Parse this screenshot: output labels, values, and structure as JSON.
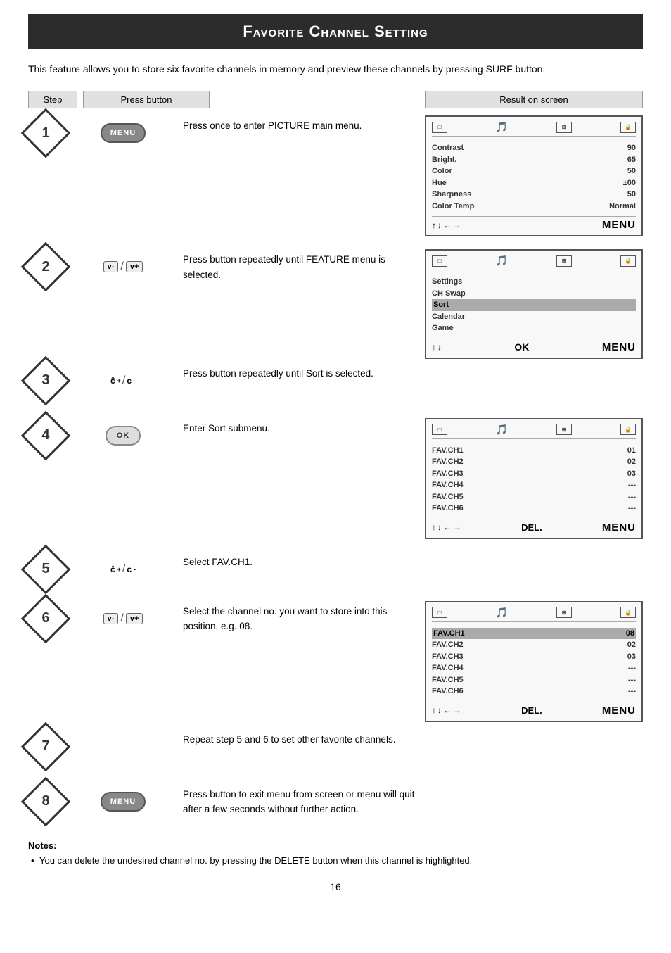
{
  "page": {
    "title": "Favorite Channel Setting",
    "intro": "This feature allows you to store six favorite channels in memory and preview these channels by pressing SURF button.",
    "page_number": "16",
    "col_step": "Step",
    "col_press": "Press  button",
    "col_result": "Result  on screen"
  },
  "steps": [
    {
      "number": "1",
      "button_type": "menu",
      "description": "Press once to enter PICTURE main menu.",
      "screen": {
        "type": "picture_menu",
        "items": [
          {
            "label": "Contrast",
            "value": "90"
          },
          {
            "label": "Bright.",
            "value": "65"
          },
          {
            "label": "Color",
            "value": "50"
          },
          {
            "label": "Hue",
            "value": "±00"
          },
          {
            "label": "Sharpness",
            "value": "50"
          },
          {
            "label": "Color Temp",
            "value": "Normal"
          }
        ],
        "nav": "menu_arrows",
        "menu_label": "MENU"
      }
    },
    {
      "number": "2",
      "button_type": "vminus_vplus",
      "description": "Press button repeatedly until FEATURE menu is selected.",
      "screen": {
        "type": "feature_menu",
        "items": [
          {
            "label": "Settings",
            "value": "",
            "highlighted": false
          },
          {
            "label": "CH Swap",
            "value": "",
            "highlighted": false
          },
          {
            "label": "Sort",
            "value": "",
            "highlighted": true
          },
          {
            "label": "Calendar",
            "value": "",
            "highlighted": false
          },
          {
            "label": "Game",
            "value": "",
            "highlighted": false
          }
        ],
        "nav": "ok_menu",
        "ok_label": "OK",
        "menu_label": "MENU"
      }
    },
    {
      "number": "3",
      "button_type": "channel",
      "description": "Press button repeatedly until Sort is selected.",
      "no_screen": true
    },
    {
      "number": "4",
      "button_type": "ok",
      "description": "Enter Sort submenu.",
      "screen": {
        "type": "sort_submenu",
        "items": [
          {
            "label": "FAV.CH1",
            "value": "01"
          },
          {
            "label": "FAV.CH2",
            "value": "02"
          },
          {
            "label": "FAV.CH3",
            "value": "03"
          },
          {
            "label": "FAV.CH4",
            "value": "---"
          },
          {
            "label": "FAV.CH5",
            "value": "---"
          },
          {
            "label": "FAV.CH6",
            "value": "---"
          }
        ],
        "nav": "del_menu",
        "del_label": "DEL.",
        "menu_label": "MENU"
      }
    },
    {
      "number": "5",
      "button_type": "channel",
      "description": "Select FAV.CH1.",
      "no_screen": true
    },
    {
      "number": "6",
      "button_type": "vminus_vplus",
      "description": "Select the channel no. you want to store into this position, e.g. 08.",
      "screen": {
        "type": "sort_submenu2",
        "items": [
          {
            "label": "FAV.CH1",
            "value": "08",
            "highlighted": true
          },
          {
            "label": "FAV.CH2",
            "value": "02"
          },
          {
            "label": "FAV.CH3",
            "value": "03"
          },
          {
            "label": "FAV.CH4",
            "value": "---"
          },
          {
            "label": "FAV.CH5",
            "value": "---"
          },
          {
            "label": "FAV.CH6",
            "value": "---"
          }
        ],
        "nav": "del_menu",
        "del_label": "DEL.",
        "menu_label": "MENU"
      }
    },
    {
      "number": "7",
      "button_type": "none",
      "description": "Repeat step 5 and 6 to set other favorite channels.",
      "no_screen": true
    },
    {
      "number": "8",
      "button_type": "menu",
      "description": "Press button to exit menu from screen or menu will quit after a few seconds without further action.",
      "no_screen": true
    }
  ],
  "notes": {
    "title": "Notes:",
    "items": [
      "You can delete the undesired channel no. by pressing the DELETE button when this channel is highlighted."
    ]
  }
}
